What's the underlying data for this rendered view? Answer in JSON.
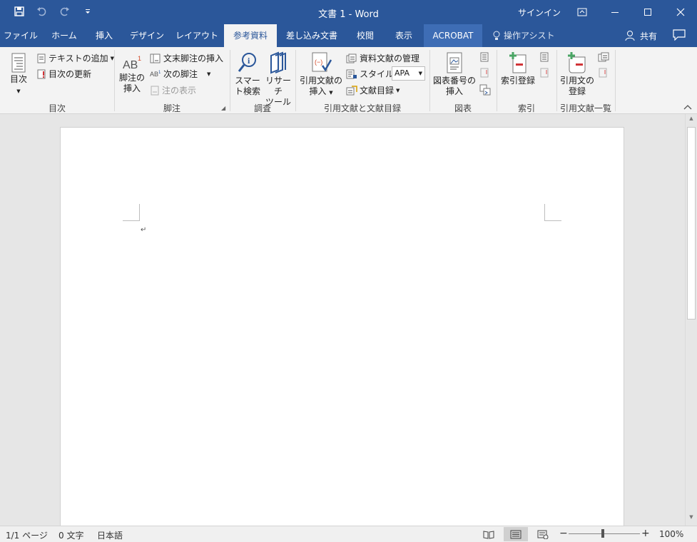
{
  "app": {
    "title": "文書 1  -  Word",
    "signin": "サインイン"
  },
  "qat": {
    "save_icon": "save-icon",
    "undo_icon": "undo-icon",
    "redo_icon": "redo-icon",
    "customize_icon": "customize-icon"
  },
  "tabs": [
    {
      "label": "ファイル"
    },
    {
      "label": "ホーム"
    },
    {
      "label": "挿入"
    },
    {
      "label": "デザイン"
    },
    {
      "label": "レイアウト"
    },
    {
      "label": "参考資料"
    },
    {
      "label": "差し込み文書"
    },
    {
      "label": "校閲"
    },
    {
      "label": "表示"
    },
    {
      "label": "ACROBAT"
    }
  ],
  "tell_me": "操作アシスト",
  "share": "共有",
  "ribbon": {
    "toc": {
      "label": "目次",
      "add_text": "テキストの追加",
      "update": "目次の更新",
      "group": "目次"
    },
    "footnotes": {
      "insert_footnote": "脚注の\n挿入",
      "insert_footnote_l1": "脚注の",
      "insert_footnote_l2": "挿入",
      "insert_endnote": "文末脚注の挿入",
      "next_footnote": "次の脚注",
      "show_notes": "注の表示",
      "group": "脚注"
    },
    "research": {
      "smart_l1": "スマー",
      "smart_l2": "ト検索",
      "researcher_l1": "リサーチ",
      "researcher_l2": "ツール",
      "group": "調査"
    },
    "citations": {
      "insert_l1": "引用文献の",
      "insert_l2": "挿入",
      "manage": "資料文献の管理",
      "style_label": "スタイル:",
      "style_value": "APA",
      "bibliography": "文献目録",
      "group": "引用文献と文献目録"
    },
    "captions": {
      "insert_l1": "図表番号の",
      "insert_l2": "挿入",
      "group": "図表"
    },
    "index": {
      "mark": "索引登録",
      "group": "索引"
    },
    "authorities": {
      "mark_l1": "引用文の",
      "mark_l2": "登録",
      "group": "引用文献一覧"
    }
  },
  "document": {
    "paragraph_mark": "↵"
  },
  "status": {
    "page": "1/1 ページ",
    "words": "0 文字",
    "language": "日本語",
    "zoom": "100%",
    "zoom_minus": "−",
    "zoom_plus": "+"
  },
  "colors": {
    "accent": "#2b579a",
    "ribbon_bg": "#f3f3f3",
    "doc_bg": "#e6e6e6"
  }
}
